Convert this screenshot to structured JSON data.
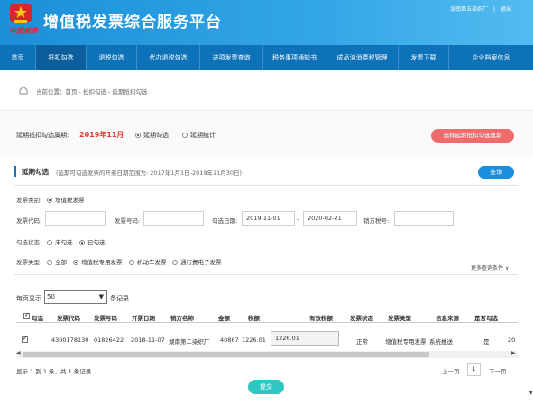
{
  "header": {
    "title": "增值税发票综合服务平台",
    "brand": "中国税务",
    "user": "湖南第五染织厂",
    "logout": "退出",
    "separator": "|"
  },
  "nav": [
    {
      "label": "首页",
      "active": false
    },
    {
      "label": "抵扣勾选",
      "active": true
    },
    {
      "label": "退税勾选",
      "active": false
    },
    {
      "label": "代办退税勾选",
      "active": false
    },
    {
      "label": "进项发票查询",
      "active": false
    },
    {
      "label": "税务事项通知书",
      "active": false
    },
    {
      "label": "成品油消费税管理",
      "active": false
    },
    {
      "label": "发票下载",
      "active": false
    },
    {
      "label": "企业档案信息",
      "active": false
    }
  ],
  "breadcrumb": "当前位置：首页 - 抵扣勾选 - 延期抵扣勾选",
  "period": {
    "label": "延期抵扣勾选属期:",
    "value": "2019年11月",
    "options": [
      {
        "label": "延期勾选",
        "selected": true
      },
      {
        "label": "延期统计",
        "selected": false
      }
    ],
    "select_button": "选择延期抵扣勾选属期"
  },
  "section": {
    "title": "延期勾选",
    "note": "(延期可勾选发票的开票日期范围为: 2017年1月1日-2019年11月30日)",
    "query_button": "查询"
  },
  "form": {
    "invoice_category_label": "发票类别:",
    "invoice_category_option": "增值税发票",
    "invoice_code_label": "发票代码:",
    "invoice_code_value": "",
    "invoice_number_label": "发票号码:",
    "invoice_number_value": "",
    "check_date_label": "勾选日期:",
    "date_from": "2019-11-01",
    "date_sep": "-",
    "date_to": "2020-02-21",
    "seller_tax_label": "销方税号:",
    "seller_tax_value": "",
    "check_status_label": "勾选状态:",
    "check_status_options": [
      {
        "label": "未勾选",
        "selected": false
      },
      {
        "label": "已勾选",
        "selected": true
      }
    ],
    "invoice_type_label": "发票类型:",
    "invoice_type_options": [
      {
        "label": "全部",
        "selected": false
      },
      {
        "label": "增值税专用发票",
        "selected": true
      },
      {
        "label": "机动车发票",
        "selected": false
      },
      {
        "label": "通行费电子发票",
        "selected": false
      }
    ],
    "more_conditions": "更多查询条件"
  },
  "table": {
    "per_page_label": "每页显示",
    "per_page_value": "50",
    "per_page_unit": "条记录",
    "headers": [
      "勾选",
      "发票代码",
      "发票号码",
      "开票日期",
      "销方名称",
      "金额",
      "税额",
      "有效税额",
      "发票状态",
      "发票类型",
      "信息来源",
      "是否勾选"
    ],
    "row": {
      "checked": true,
      "code": "4300178130",
      "number": "01826422",
      "date": "2018-11-07",
      "seller": "湖南第二染织厂",
      "amount": "40867",
      "tax": "1226.01",
      "valid_tax": "1226.01",
      "status": "正常",
      "type": "增值税专用发票",
      "source": "系统推送",
      "is_checked": "是",
      "overflow": "20"
    },
    "summary": "显示 1 到 1 条，共 1 条记录",
    "prev": "上一页",
    "page": "1",
    "next": "下一页"
  },
  "submit": "提交"
}
